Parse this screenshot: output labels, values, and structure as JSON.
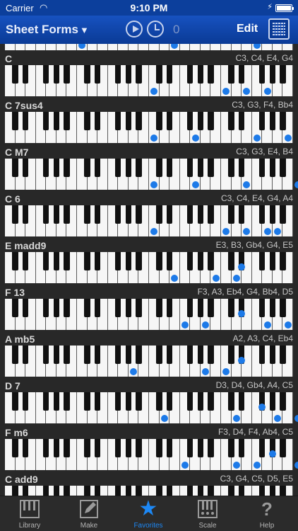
{
  "status": {
    "carrier": "Carrier",
    "time": "9:10 PM"
  },
  "nav": {
    "title": "Sheet Forms",
    "count": "0",
    "edit": "Edit"
  },
  "chords": [
    {
      "name": "C",
      "notes": "C3, C4, E4, G4",
      "keys": [
        14,
        21,
        23,
        25
      ]
    },
    {
      "name": "C 7sus4",
      "notes": "C3, G3, F4, Bb4",
      "keys": [
        14,
        18,
        24,
        27
      ]
    },
    {
      "name": "C M7",
      "notes": "C3, G3, E4, B4",
      "keys": [
        14,
        18,
        23,
        28
      ]
    },
    {
      "name": "C 6",
      "notes": "C3, C4, E4, G4, A4",
      "keys": [
        14,
        21,
        23,
        25,
        26
      ]
    },
    {
      "name": "E madd9",
      "notes": "E3, B3, Gb4, G4, E5",
      "keys": [
        16,
        20,
        22,
        22.6,
        30
      ]
    },
    {
      "name": "F 13",
      "notes": "F3, A3, Eb4, G4, Bb4, D5",
      "keys": [
        17,
        19,
        22.6,
        25,
        27,
        29
      ]
    },
    {
      "name": "A mb5",
      "notes": "A2, A3, C4, Eb4",
      "keys": [
        12,
        19,
        21,
        22.6
      ]
    },
    {
      "name": "D 7",
      "notes": "D3, D4, Gb4, A4, C5",
      "keys": [
        15,
        22,
        24.6,
        26,
        28
      ]
    },
    {
      "name": "F m6",
      "notes": "F3, D4, F4, Ab4, C5",
      "keys": [
        17,
        22,
        24,
        25.6,
        28
      ]
    },
    {
      "name": "C add9",
      "notes": "C3, G4, C5, D5, E5",
      "keys": []
    }
  ],
  "tabs": [
    {
      "label": "Library",
      "icon": "library-icon"
    },
    {
      "label": "Make",
      "icon": "pencil-icon"
    },
    {
      "label": "Favorites",
      "icon": "star-icon"
    },
    {
      "label": "Scale",
      "icon": "scale-keys-icon"
    },
    {
      "label": "Help",
      "icon": "help-icon"
    }
  ],
  "colors": {
    "accent": "#1d88f5",
    "nav": "#0c3f9c",
    "dot": "#1d7ae8"
  }
}
